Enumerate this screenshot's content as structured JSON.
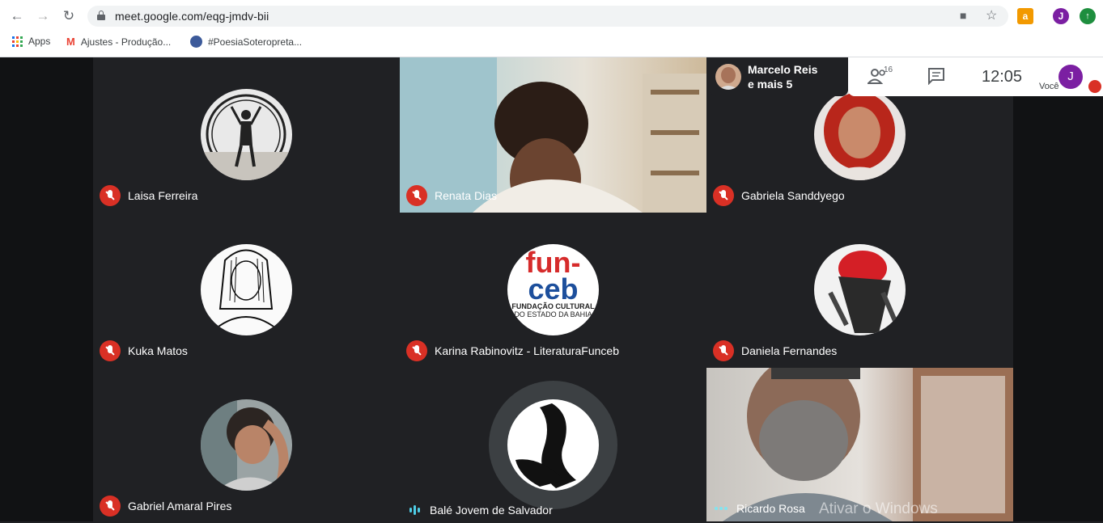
{
  "browser": {
    "url": "meet.google.com/eqg-jmdv-bii",
    "profile_initial": "J",
    "bookmarks": [
      {
        "label": "Apps"
      },
      {
        "label": "Ajustes - Produção..."
      },
      {
        "label": "#PoesiaSoteropreta..."
      }
    ]
  },
  "meet": {
    "presenter": {
      "line1": "Marcelo Reis",
      "line2": "e mais 5"
    },
    "participant_count": "16",
    "time": "12:05",
    "self_label": "Você",
    "self_initial": "J",
    "tiles": [
      {
        "name": "Laisa Ferreira",
        "status": "muted"
      },
      {
        "name": "Renata Dias",
        "status": "muted"
      },
      {
        "name": "Gabriela Sanddyego",
        "status": "muted"
      },
      {
        "name": "Kuka Matos",
        "status": "muted"
      },
      {
        "name": "Karina Rabinovitz - LiteraturaFunceb",
        "status": "muted"
      },
      {
        "name": "Daniela Fernandes",
        "status": "muted"
      },
      {
        "name": "Gabriel Amaral Pires",
        "status": "muted"
      },
      {
        "name": "Balé Jovem de Salvador",
        "status": "speaking"
      },
      {
        "name": "Ricardo Rosa",
        "status": "active"
      }
    ],
    "funceb_logo": {
      "line1": "fun-",
      "line2": "ceb",
      "line3": "FUNDAÇÃO CULTURAL",
      "line4": "DO ESTADO DA BAHIA"
    }
  },
  "os_watermark": "Ativar o Windows",
  "colors": {
    "mute_red": "#d93025",
    "meet_bg": "#202124",
    "profile_purple": "#7b1fa2"
  }
}
